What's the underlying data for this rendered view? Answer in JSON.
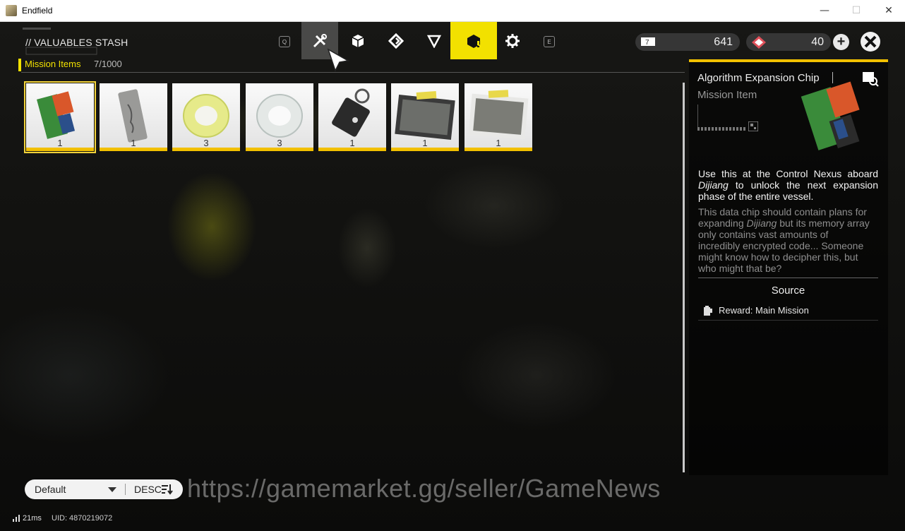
{
  "window": {
    "title": "Endfield",
    "minimize": "—",
    "maximize": "☐",
    "close": "✕"
  },
  "header": {
    "page_title": "// VALUABLES STASH",
    "key_prev": "Q",
    "key_next": "E",
    "categories": [
      {
        "icon": "tools-icon",
        "state": "hover"
      },
      {
        "icon": "cube-icon",
        "state": "normal"
      },
      {
        "icon": "diamond-arrow-icon",
        "state": "normal"
      },
      {
        "icon": "triangle-icon",
        "state": "normal"
      },
      {
        "icon": "mission-box-icon",
        "state": "active"
      },
      {
        "icon": "gear-icon",
        "state": "normal"
      }
    ],
    "currencies": [
      {
        "icon": "ticket-icon",
        "value": "641"
      },
      {
        "icon": "origeometry-icon",
        "value": "40"
      }
    ],
    "add_label": "+",
    "close_icon": "close-icon"
  },
  "stash": {
    "tab_label": "Mission Items",
    "count": "7/1000",
    "items": [
      {
        "icon": "algorithm-chip-icon",
        "count": "1",
        "selected": true
      },
      {
        "icon": "metal-tag-icon",
        "count": "1"
      },
      {
        "icon": "glowing-ring-icon",
        "count": "3"
      },
      {
        "icon": "clear-ring-icon",
        "count": "3"
      },
      {
        "icon": "keycard-icon",
        "count": "1"
      },
      {
        "icon": "photo-icon",
        "count": "1"
      },
      {
        "icon": "photo-icon",
        "count": "1"
      }
    ]
  },
  "detail": {
    "name": "Algorithm Expansion Chip",
    "type": "Mission Item",
    "description_parts": [
      "Use this at the Control Nexus aboard ",
      "Dijiang",
      " to unlock the next expansion phase of the entire vessel."
    ],
    "lore_parts": [
      "This data chip should contain plans for expanding ",
      "Dijiang",
      " but its memory array only contains vast amounts of incredibly encrypted code... Someone might know how to decipher this, but who might that be?"
    ],
    "source_heading": "Source",
    "sources": [
      {
        "icon": "mission-icon",
        "label": "Reward: Main Mission"
      }
    ]
  },
  "sort": {
    "option": "Default",
    "order": "DESC"
  },
  "status": {
    "ping": "21ms",
    "uid": "UID: 4870219072"
  },
  "watermark": "https://gamemarket.gg/seller/GameNews",
  "colors": {
    "accent": "#f2e100",
    "rarity_bar": "#f2c000"
  }
}
